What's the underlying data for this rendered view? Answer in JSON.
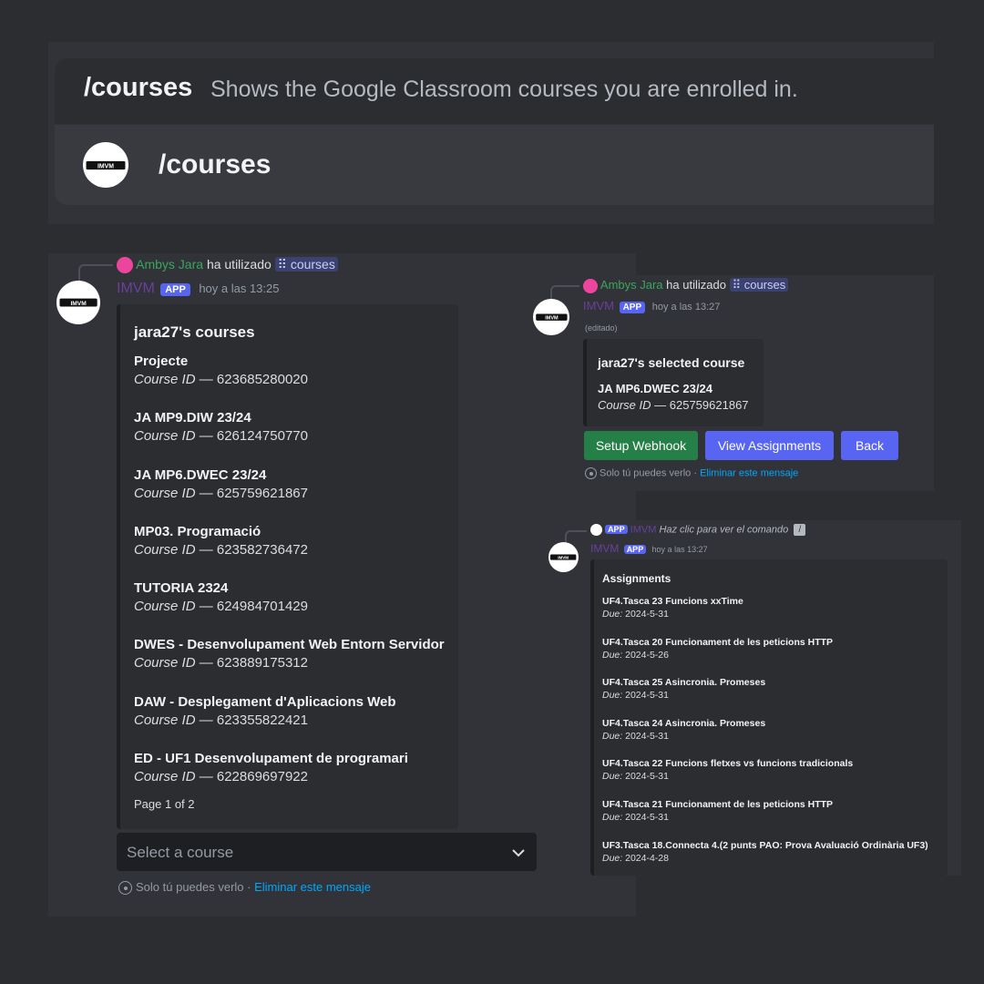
{
  "command_bar": {
    "name": "/courses",
    "description": "Shows the Google Classroom courses you are enrolled in.",
    "option": "/courses"
  },
  "left_message": {
    "user": "Ambys Jara",
    "used_text": "ha utilizado",
    "command": "courses",
    "bot_name": "IMVM",
    "badge": "APP",
    "timestamp": "hoy a las 13:25",
    "embed_title": "jara27's courses",
    "id_label": "Course ID",
    "dash": " — ",
    "courses": [
      {
        "name": "Projecte",
        "id": "623685280020"
      },
      {
        "name": "JA MP9.DIW 23/24",
        "id": "626124750770"
      },
      {
        "name": "JA MP6.DWEC 23/24",
        "id": "625759621867"
      },
      {
        "name": "MP03. Programació",
        "id": "623582736472"
      },
      {
        "name": "TUTORIA 2324",
        "id": "624984701429"
      },
      {
        "name": "DWES - Desenvolupament Web Entorn Servidor",
        "id": "623889175312"
      },
      {
        "name": "DAW - Desplegament d'Aplicacions Web",
        "id": "623355822421"
      },
      {
        "name": "ED - UF1 Desenvolupament de programari",
        "id": "622869697922"
      }
    ],
    "footer": "Page 1 of 2",
    "select_placeholder": "Select a course",
    "ephemeral_text": "Solo tú puedes verlo · ",
    "delete_link": "Eliminar este mensaje"
  },
  "right_top_message": {
    "user": "Ambys Jara",
    "used_text": "ha utilizado",
    "command": "courses",
    "bot_name": "IMVM",
    "badge": "APP",
    "timestamp": "hoy a las 13:27",
    "edited": "(editado)",
    "embed_title": "jara27's selected course",
    "course_name": "JA MP6.DWEC 23/24",
    "id_label": "Course ID",
    "dash": " — ",
    "course_id": "625759621867",
    "buttons": {
      "setup_webhook": "Setup Webhook",
      "view_assignments": "View Assignments",
      "back": "Back"
    },
    "ephemeral_text": "Solo tú puedes verlo · ",
    "delete_link": "Eliminar este mensaje"
  },
  "right_bottom_message": {
    "reply_badge": "APP",
    "reply_bot": "IMVM",
    "reply_text": "Haz clic para ver el comando",
    "bot_name": "IMVM",
    "badge": "APP",
    "timestamp": "hoy a las 13:27",
    "embed_title": "Assignments",
    "due_label": "Due:",
    "assignments": [
      {
        "name": "UF4.Tasca 23 Funcions xxTime",
        "due": "2024-5-31"
      },
      {
        "name": "UF4.Tasca 20 Funcionament de les peticions HTTP",
        "due": "2024-5-26"
      },
      {
        "name": "UF4.Tasca 25 Asincronia. Promeses",
        "due": "2024-5-31"
      },
      {
        "name": "UF4.Tasca 24 Asincronia. Promeses",
        "due": "2024-5-31"
      },
      {
        "name": "UF4.Tasca 22 Funcions fletxes vs funcions tradicionals",
        "due": "2024-5-31"
      },
      {
        "name": "UF4.Tasca 21 Funcionament de les peticions HTTP",
        "due": "2024-5-31"
      },
      {
        "name": "UF3.Tasca 18.Connecta 4.(2 punts PAO: Prova Avaluació Ordinària UF3)",
        "due": "2024-4-28"
      }
    ]
  },
  "colors": {
    "background": "#2b2d31",
    "panel": "#313338",
    "blurple": "#5865f2",
    "success": "#248046",
    "link": "#00a8fc",
    "username_green": "#3ba55c"
  },
  "icons": {
    "avatar": "imvm-logo",
    "chevron": "chevron-down-icon",
    "eye": "eye-icon",
    "command": "slash-command-icon",
    "edit": "pencil-icon"
  }
}
